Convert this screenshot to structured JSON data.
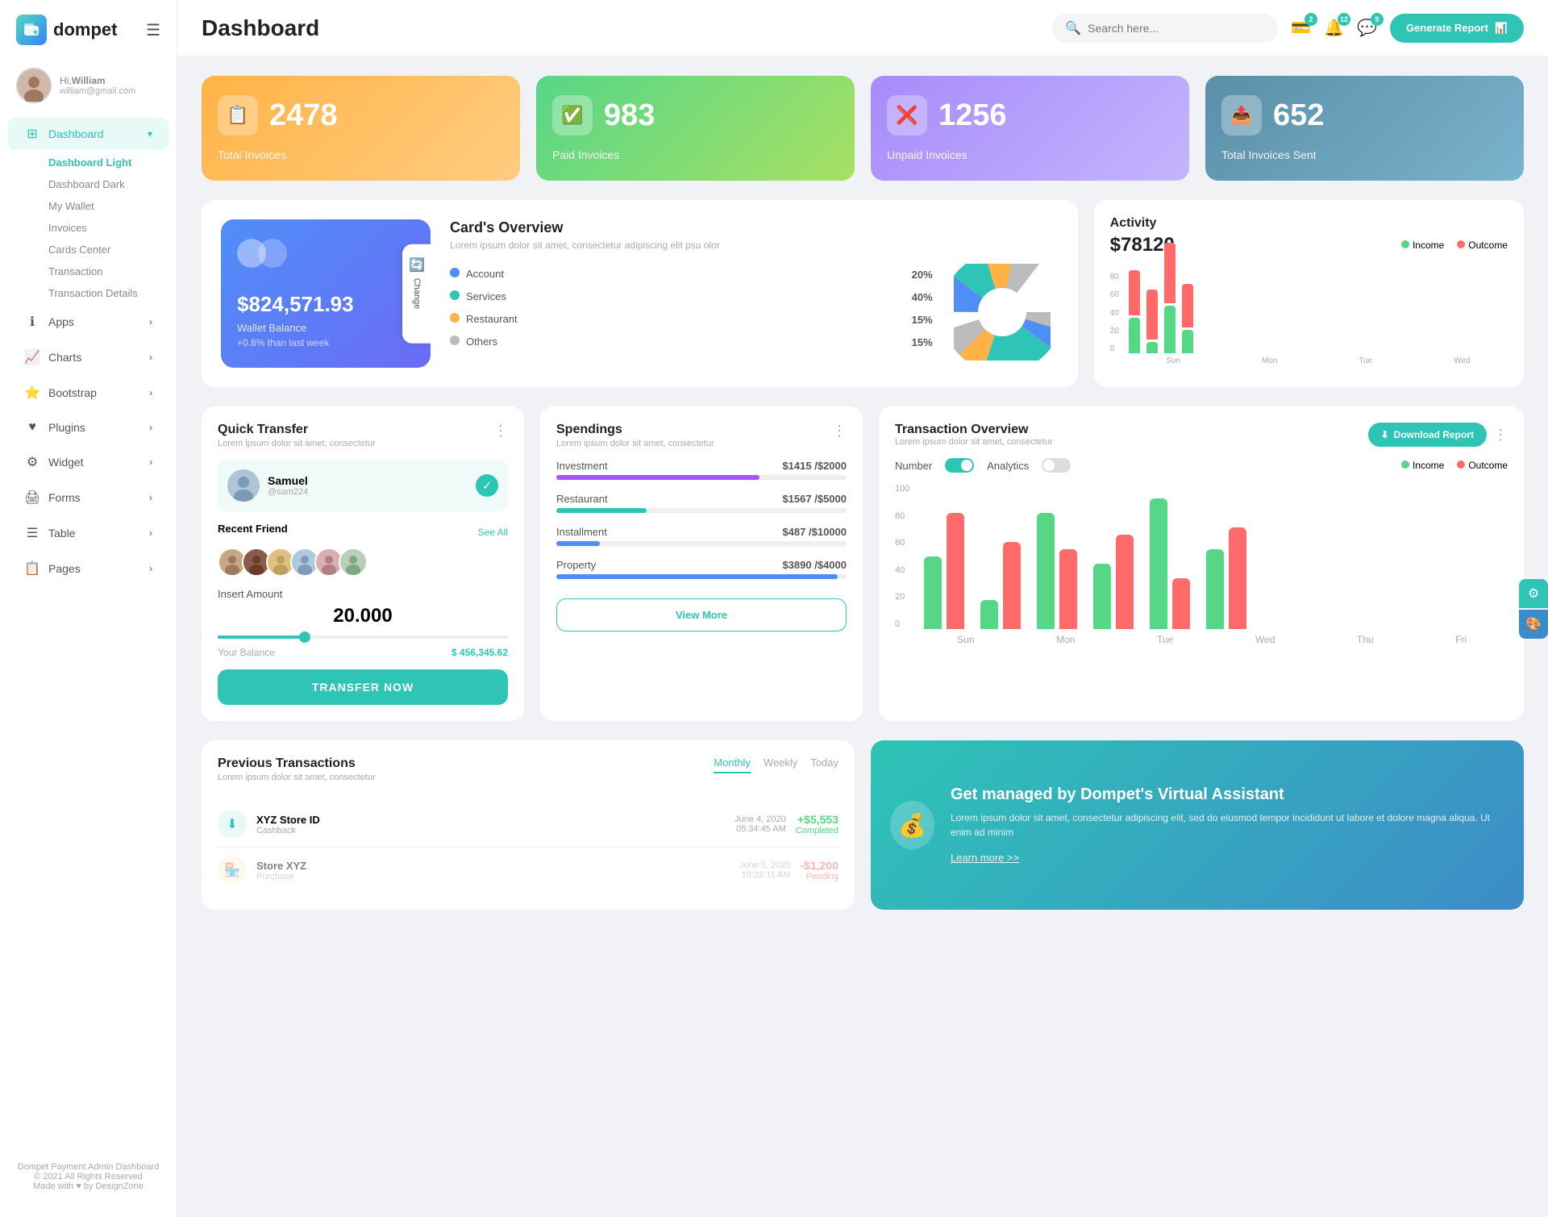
{
  "app": {
    "logo_text": "dompet",
    "logo_icon": "💳"
  },
  "header": {
    "title": "Dashboard",
    "search_placeholder": "Search here...",
    "generate_btn": "Generate Report",
    "badges": {
      "wallet": "2",
      "bell": "12",
      "chat": "5"
    }
  },
  "user": {
    "greeting": "Hi,",
    "name": "William",
    "email": "william@gmail.com"
  },
  "sidebar": {
    "dashboard_label": "Dashboard",
    "subnav": [
      {
        "label": "Dashboard Light",
        "active": true
      },
      {
        "label": "Dashboard Dark",
        "active": false
      },
      {
        "label": "My Wallet",
        "active": false
      },
      {
        "label": "Invoices",
        "active": false
      },
      {
        "label": "Cards Center",
        "active": false
      },
      {
        "label": "Transaction",
        "active": false
      },
      {
        "label": "Transaction Details",
        "active": false
      }
    ],
    "nav_items": [
      {
        "label": "Apps",
        "icon": "ℹ️"
      },
      {
        "label": "Charts",
        "icon": "📈"
      },
      {
        "label": "Bootstrap",
        "icon": "⭐"
      },
      {
        "label": "Plugins",
        "icon": "❤️"
      },
      {
        "label": "Widget",
        "icon": "⚙️"
      },
      {
        "label": "Forms",
        "icon": "🖨️"
      },
      {
        "label": "Table",
        "icon": "☰"
      },
      {
        "label": "Pages",
        "icon": "📋"
      }
    ],
    "footer_line1": "Dompet Payment Admin Dashboard",
    "footer_line2": "© 2021 All Rights Reserved",
    "footer_line3": "Made with ♥ by DesignZone"
  },
  "stats": [
    {
      "id": "total",
      "number": "2478",
      "label": "Total Invoices",
      "color": "orange",
      "icon": "📋"
    },
    {
      "id": "paid",
      "number": "983",
      "label": "Paid Invoices",
      "color": "green",
      "icon": "✅"
    },
    {
      "id": "unpaid",
      "number": "1256",
      "label": "Unpaid Invoices",
      "color": "purple",
      "icon": "❌"
    },
    {
      "id": "sent",
      "number": "652",
      "label": "Total Invoices Sent",
      "color": "teal",
      "icon": "📤"
    }
  ],
  "card_overview": {
    "wallet_amount": "$824,571.93",
    "wallet_label": "Wallet Balance",
    "wallet_change": "+0.8% than last week",
    "change_btn": "Change",
    "title": "Card's Overview",
    "subtitle": "Lorem ipsum dolor sit amet, consectetur adipiscing elit psu olor",
    "categories": [
      {
        "name": "Account",
        "pct": "20%",
        "color": "#4f8ef7"
      },
      {
        "name": "Services",
        "pct": "40%",
        "color": "#2ec4b6"
      },
      {
        "name": "Restaurant",
        "pct": "15%",
        "color": "#ffb347"
      },
      {
        "name": "Others",
        "pct": "15%",
        "color": "#bbb"
      }
    ]
  },
  "activity": {
    "title": "Activity",
    "amount": "$78120",
    "legend": [
      {
        "label": "Income",
        "color": "#56d687"
      },
      {
        "label": "Outcome",
        "color": "#ff6b6b"
      }
    ],
    "bars": [
      {
        "label": "Sun",
        "income": 45,
        "outcome": 70
      },
      {
        "label": "Mon",
        "income": 15,
        "outcome": 50
      },
      {
        "label": "Tue",
        "income": 60,
        "outcome": 75
      },
      {
        "label": "Wed",
        "income": 30,
        "outcome": 55
      }
    ],
    "y_labels": [
      "80",
      "60",
      "40",
      "20",
      "0"
    ]
  },
  "quick_transfer": {
    "title": "Quick Transfer",
    "subtitle": "Lorem ipsum dolor sit amet, consectetur",
    "friend_name": "Samuel",
    "friend_handle": "@sam224",
    "recent_label": "Recent Friend",
    "see_all": "See All",
    "amount_label": "Insert Amount",
    "amount": "20.000",
    "balance_label": "Your Balance",
    "balance": "$ 456,345.62",
    "btn_label": "TRANSFER NOW"
  },
  "spendings": {
    "title": "Spendings",
    "subtitle": "Lorem ipsum dolor sit amet, consectetur",
    "items": [
      {
        "name": "Investment",
        "amount": "$1415",
        "max": "$2000",
        "fill": 70,
        "color": "#a855f7"
      },
      {
        "name": "Restaurant",
        "amount": "$1567",
        "max": "$5000",
        "fill": 31,
        "color": "#2ec4b6"
      },
      {
        "name": "Installment",
        "amount": "$487",
        "max": "$10000",
        "fill": 15,
        "color": "#4f8ef7"
      },
      {
        "name": "Property",
        "amount": "$3890",
        "max": "$4000",
        "fill": 97,
        "color": "#4f8ef7"
      }
    ],
    "view_more": "View More"
  },
  "transaction_overview": {
    "title": "Transaction Overview",
    "subtitle": "Lorem ipsum dolor sit amet, consectetur",
    "download_btn": "Download Report",
    "toggle_number": "Number",
    "toggle_analytics": "Analytics",
    "legend": [
      {
        "label": "Income",
        "color": "#56d687"
      },
      {
        "label": "Outcome",
        "color": "#ff6b6b"
      }
    ],
    "bars": [
      {
        "label": "Sun",
        "income": 50,
        "outcome": 80
      },
      {
        "label": "Mon",
        "income": 20,
        "outcome": 60
      },
      {
        "label": "Tue",
        "income": 80,
        "outcome": 55
      },
      {
        "label": "Wed",
        "income": 45,
        "outcome": 65
      },
      {
        "label": "Thu",
        "income": 90,
        "outcome": 35
      },
      {
        "label": "Fri",
        "income": 55,
        "outcome": 70
      }
    ],
    "y_labels": [
      "100",
      "80",
      "60",
      "40",
      "20",
      "0"
    ]
  },
  "prev_transactions": {
    "title": "Previous Transactions",
    "subtitle": "Lorem ipsum dolor sit amet, consectetur",
    "tabs": [
      "Monthly",
      "Weekly",
      "Today"
    ],
    "active_tab": "Monthly",
    "transactions": [
      {
        "name": "XYZ Store ID",
        "sub": "Cashback",
        "date": "June 4, 2020",
        "time": "05:34:45 AM",
        "amount": "+$5,553",
        "status": "Completed"
      }
    ]
  },
  "virtual_assistant": {
    "title": "Get managed by Dompet's Virtual Assistant",
    "subtitle": "Lorem ipsum dolor sit amet, consectetur adipiscing elit, sed do eiusmod tempor incididunt ut labore et dolore magna aliqua. Ut enim ad minim",
    "link": "Learn more >>"
  }
}
